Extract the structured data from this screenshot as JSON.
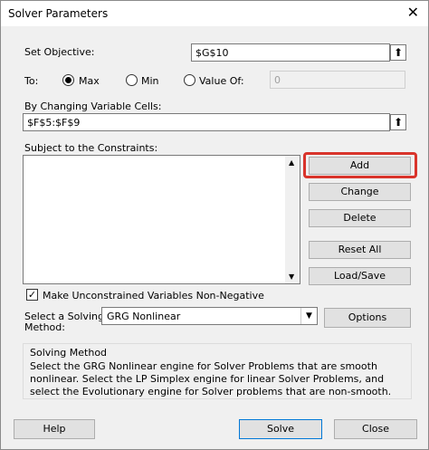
{
  "window": {
    "title": "Solver Parameters",
    "close_glyph": "✕"
  },
  "objective": {
    "label": "Set Objective:",
    "value": "$G$10"
  },
  "to": {
    "label": "To:",
    "options": [
      "Max",
      "Min",
      "Value Of:"
    ],
    "selected": "Max",
    "value_of": "0"
  },
  "changing_cells": {
    "label": "By Changing Variable Cells:",
    "value": "$F$5:$F$9"
  },
  "constraints": {
    "label": "Subject to the Constraints:"
  },
  "buttons": {
    "add": "Add",
    "change": "Change",
    "delete": "Delete",
    "reset_all": "Reset All",
    "load_save": "Load/Save",
    "options": "Options",
    "help": "Help",
    "solve": "Solve",
    "close": "Close"
  },
  "nonneg": {
    "label": "Make Unconstrained Variables Non-Negative",
    "checked": true
  },
  "solving_method": {
    "label_line1": "Select a Solving",
    "label_line2": "Method:",
    "selected": "GRG Nonlinear",
    "group_title": "Solving Method",
    "description": "Select the GRG Nonlinear engine for Solver Problems that are smooth nonlinear. Select the LP Simplex engine for linear Solver Problems, and select the Evolutionary engine for Solver problems that are non-smooth."
  },
  "accent": {
    "highlight": "#d9342b",
    "dialog_bg": "#f0f0f0"
  }
}
